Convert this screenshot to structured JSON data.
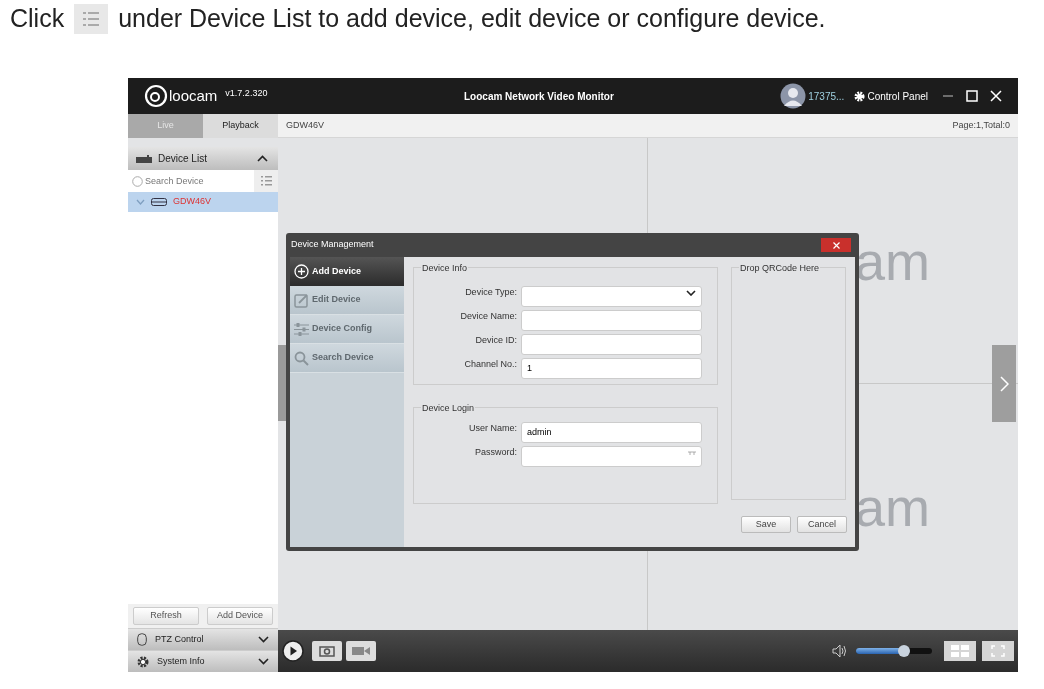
{
  "instruction": {
    "before": "Click",
    "after": "under Device List to add device, edit device or configure device."
  },
  "window": {
    "logo": "loocam",
    "version": "v1.7.2.320",
    "title": "Loocam Network Video Monitor",
    "user": "17375...",
    "control_panel": "Control Panel"
  },
  "tabs": [
    {
      "label": "Live",
      "selected": true
    },
    {
      "label": "Playback",
      "selected": false
    }
  ],
  "view_header": {
    "device": "GDW46V",
    "paging": "Page:1,Total:0"
  },
  "sidebar": {
    "device_list": {
      "title": "Device List",
      "expanded": true
    },
    "search": {
      "placeholder": "Search Device"
    },
    "tree": [
      {
        "label": "GDW46V",
        "expanded": true,
        "selected": true
      }
    ],
    "buttons": [
      "Refresh",
      "Add Device"
    ],
    "sections": [
      {
        "title": "PTZ Control",
        "kind": "ptz",
        "expanded": false
      },
      {
        "title": "System Info",
        "kind": "system",
        "expanded": false
      }
    ]
  },
  "video_panes": {
    "top_right": {
      "logo_fragment": "am"
    },
    "bottom_right": {
      "logo_fragment": "am"
    }
  },
  "toolbar": {
    "volume": {
      "level": 0.63
    }
  },
  "dialog": {
    "title": "Device Management",
    "nav": [
      {
        "label": "Add Device",
        "kind": "add",
        "selected": true
      },
      {
        "label": "Edit Device",
        "kind": "edit",
        "selected": false
      },
      {
        "label": "Device Config",
        "kind": "config",
        "selected": false
      },
      {
        "label": "Search Device",
        "kind": "search",
        "selected": false
      }
    ],
    "device_info": {
      "title": "Device Info",
      "fields": [
        {
          "label": "Device Type:",
          "kind": "select"
        },
        {
          "label": "Device Name:",
          "kind": "text"
        },
        {
          "label": "Device ID:",
          "kind": "text"
        },
        {
          "label": "Channel No.:",
          "kind": "text",
          "value": "1"
        }
      ]
    },
    "device_login": {
      "title": "Device Login",
      "fields": [
        {
          "label": "User Name:",
          "kind": "text",
          "value": "admin"
        },
        {
          "label": "Password:",
          "kind": "password"
        }
      ]
    },
    "qr": {
      "title": "Drop QRCode Here"
    },
    "buttons": [
      "Save",
      "Cancel"
    ]
  }
}
